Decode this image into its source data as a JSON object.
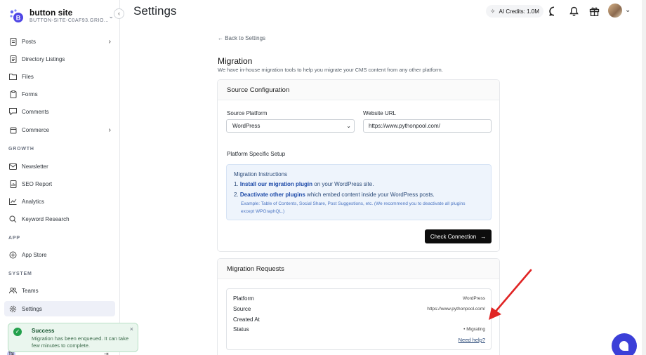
{
  "sidebar": {
    "brand_title": "button site",
    "brand_subtitle": "BUTTON-SITE-C0AF93.GRIO...",
    "items": [
      {
        "label": "Posts",
        "icon": "document-icon"
      },
      {
        "label": "Directory Listings",
        "icon": "list-icon"
      },
      {
        "label": "Files",
        "icon": "folder-icon"
      },
      {
        "label": "Forms",
        "icon": "clipboard-icon"
      },
      {
        "label": "Comments",
        "icon": "comment-icon"
      },
      {
        "label": "Commerce",
        "icon": "cart-icon"
      },
      {
        "label": "Newsletter",
        "icon": "mail-icon"
      },
      {
        "label": "SEO Report",
        "icon": "report-icon"
      },
      {
        "label": "Analytics",
        "icon": "chart-icon"
      },
      {
        "label": "Keyword Research",
        "icon": "search-icon"
      },
      {
        "label": "App Store",
        "icon": "store-icon"
      },
      {
        "label": "Teams",
        "icon": "users-icon"
      },
      {
        "label": "Settings",
        "icon": "gear-icon"
      }
    ],
    "sections": {
      "growth": "GROWTH",
      "app": "APP",
      "system": "SYSTEM"
    },
    "user_initials": "TS"
  },
  "toast": {
    "title": "Success",
    "message": "Migration has been enqueued. It can take few minutes to complete.",
    "close": "×"
  },
  "header": {
    "title": "Settings",
    "credits": "AI Credits: 1.0M"
  },
  "main": {
    "back_link": "← Back to Settings",
    "title": "Migration",
    "subtitle": "We have in-house migration tools to help you migrate your CMS content from any other platform.",
    "source_config": {
      "heading": "Source Configuration",
      "platform_label": "Source Platform",
      "platform_value": "WordPress",
      "url_label": "Website URL",
      "url_value": "https://www.pythonpool.com/",
      "setup_heading": "Platform Specific Setup",
      "instructions_title": "Migration Instructions",
      "step1_num": "1.",
      "step1_link": "Install our migration plugin",
      "step1_rest": " on your WordPress site.",
      "step2_num": "2.",
      "step2_link": "Deactivate other plugins",
      "step2_rest": " which embed content inside your WordPress posts.",
      "note": "Example: Table of Contents, Social Share, Post Suggestions, etc. (We recommend you to deactivate all plugins except WPGraphQL.)",
      "check_button": "Check Connection",
      "check_arrow": "→"
    },
    "requests": {
      "heading": "Migration Requests",
      "rows": [
        {
          "label": "Platform",
          "value": "WordPress"
        },
        {
          "label": "Source",
          "value": "https://www.pythonpool.com/"
        },
        {
          "label": "Created At",
          "value": ""
        },
        {
          "label": "Status",
          "value": "• Migrating"
        }
      ],
      "help_link": "Need help?"
    }
  },
  "colors": {
    "accent": "#3b3fd8",
    "annotation_arrow": "#e02424",
    "success": "#22a04b"
  }
}
